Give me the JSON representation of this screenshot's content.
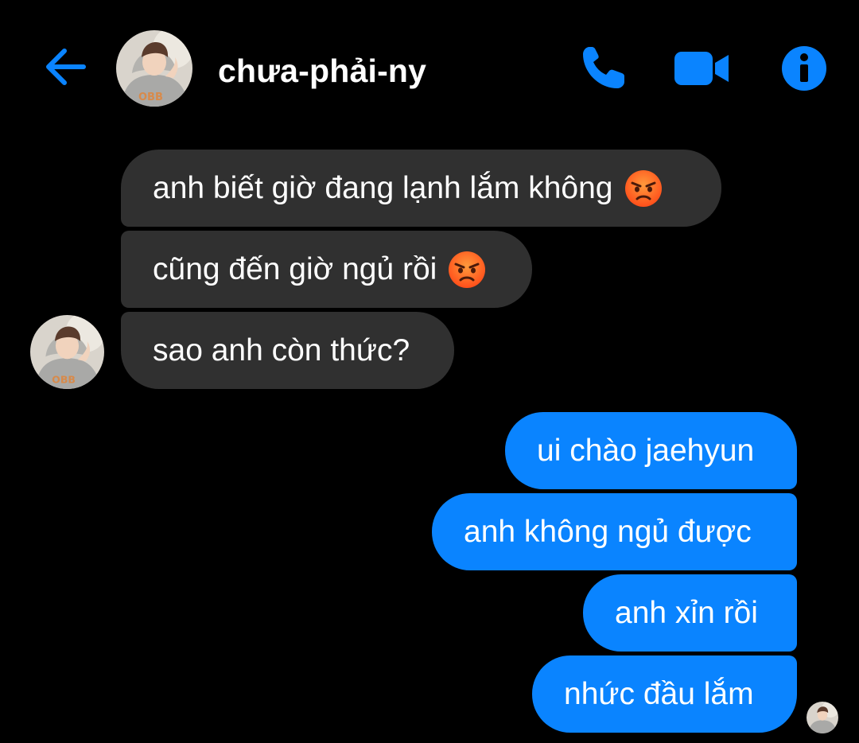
{
  "header": {
    "contact_name": "chưa-phải-ny",
    "back_icon": "arrow-left-icon",
    "call_icon": "phone-icon",
    "video_icon": "video-camera-icon",
    "info_icon": "info-icon",
    "accent_color": "#0a84ff"
  },
  "messages": {
    "incoming": [
      {
        "text": "anh biết giờ đang lạnh lắm không",
        "emoji": "angry-face-emoji"
      },
      {
        "text": "cũng đến giờ ngủ rồi",
        "emoji": "angry-face-emoji"
      },
      {
        "text": "sao anh còn thức?"
      }
    ],
    "outgoing": [
      {
        "text": "ui chào jaehyun"
      },
      {
        "text": "anh không ngủ được"
      },
      {
        "text": "anh xỉn rồi"
      },
      {
        "text": "nhức đầu lắm"
      }
    ]
  },
  "colors": {
    "background": "#000000",
    "incoming_bubble": "#303030",
    "outgoing_bubble": "#0a84ff"
  }
}
